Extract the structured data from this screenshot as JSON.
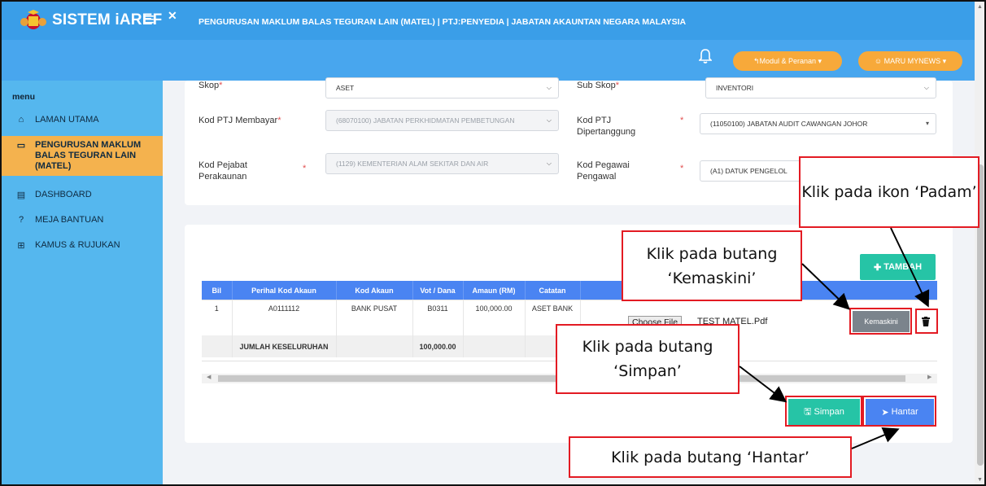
{
  "header": {
    "brand": "SISTEM iAREF",
    "page_title": "PENGURUSAN MAKLUM BALAS TEGURAN LAIN (MATEL) | PTJ:PENYEDIA | JABATAN AKAUNTAN NEGARA MALAYSIA",
    "modul_button": "↰Modul & Peranan ▾",
    "user_button": "☺ MARU MYNEWS ▾",
    "accent_color": "#3a9ee8",
    "button_color": "#f7a93a"
  },
  "sidebar": {
    "menu_label": "menu",
    "items": [
      {
        "label": "LAMAN UTAMA",
        "icon": "home-icon"
      },
      {
        "label": "PENGURUSAN MAKLUM BALAS TEGURAN LAIN (MATEL)",
        "icon": "monitor-icon",
        "active": true
      },
      {
        "label": "DASHBOARD",
        "icon": "dashboard-icon"
      },
      {
        "label": "MEJA BANTUAN",
        "icon": "question-icon"
      },
      {
        "label": "KAMUS & RUJUKAN",
        "icon": "book-icon"
      }
    ]
  },
  "form": {
    "skop": {
      "label": "Skop",
      "value": "ASET"
    },
    "sub_skop": {
      "label": "Sub Skop",
      "value": "INVENTORI"
    },
    "kod_ptj_membayar": {
      "label": "Kod PTJ Membayar",
      "value": "(68070100) JABATAN PERKHIDMATAN PEMBETUNGAN"
    },
    "kod_ptj_dipertanggung": {
      "label": "Kod PTJ Dipertanggung",
      "value": "(11050100) JABATAN AUDIT CAWANGAN JOHOR"
    },
    "kod_pejabat_perakaunan": {
      "label": "Kod Pejabat Perakaunan",
      "value": "(1129) KEMENTERIAN ALAM SEKITAR DAN AIR"
    },
    "kod_pegawai_pengawal": {
      "label": "Kod Pegawai Pengawal",
      "value": "(A1) DATUK PENGELOL"
    },
    "required_mark": "*"
  },
  "table": {
    "add_button": "TAMBAH",
    "headers": [
      "Bil",
      "Perihal Kod Akaun",
      "Kod Akaun",
      "Vot / Dana",
      "Amaun (RM)",
      "Catatan"
    ],
    "row": {
      "bil": "1",
      "perihal": "A0111112",
      "kod_akaun": "BANK PUSAT",
      "vot": "B0311",
      "amaun": "100,000.00",
      "catatan": "ASET BANK"
    },
    "total": {
      "label": "JUMLAH KESELURUHAN",
      "amaun": "100,000.00"
    },
    "choose_file": "Choose File",
    "file_name": "TEST MATEL.Pdf",
    "update_button": "Kemaskini"
  },
  "actions": {
    "save_button": "Simpan",
    "send_button": "Hantar"
  },
  "callouts": {
    "padam": "Klik pada ikon ‘Padam’",
    "kemaskini": "Klik pada butang ‘Kemaskini’",
    "simpan": "Klik pada butang ‘Simpan’",
    "hantar": "Klik pada butang ‘Hantar’"
  }
}
